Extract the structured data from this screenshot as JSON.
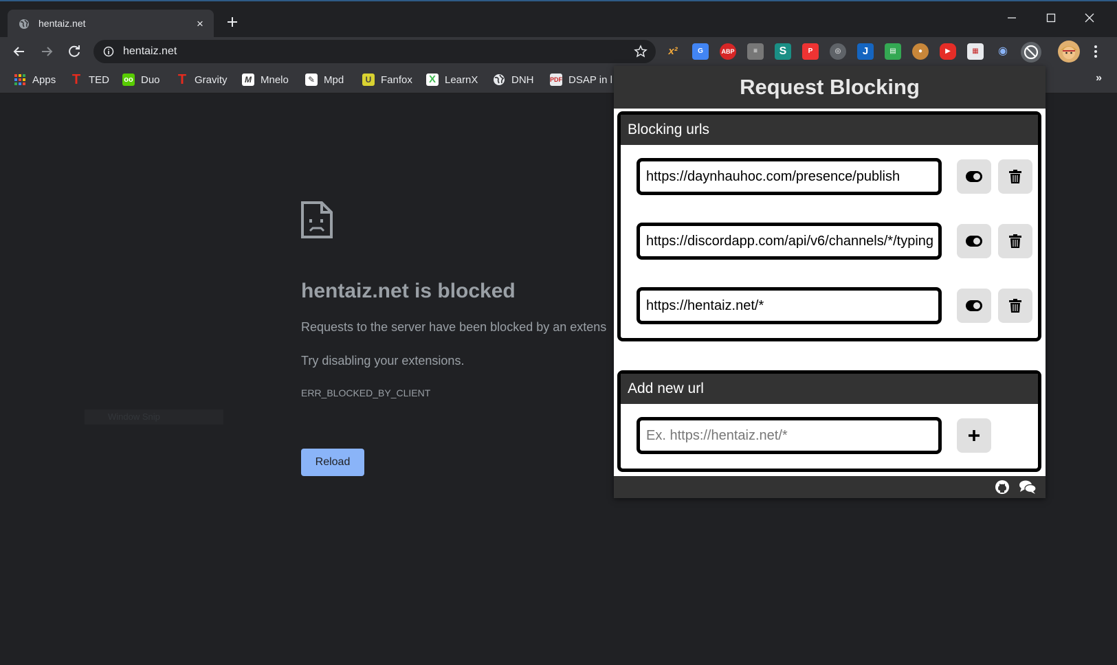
{
  "browser": {
    "tab_title": "hentaiz.net",
    "tab_close": "×",
    "address": "hentaiz.net",
    "bookmarks": [
      {
        "label": "Apps",
        "color": "#ea4335"
      },
      {
        "label": "TED",
        "color": "#e62b1e"
      },
      {
        "label": "Duo",
        "color": "#58cc02"
      },
      {
        "label": "Gravity",
        "color": "#e62b1e"
      },
      {
        "label": "Mnelo",
        "color": "#ffffff"
      },
      {
        "label": "Mpd",
        "color": "#ffffff"
      },
      {
        "label": "Fanfox",
        "color": "#d9d231"
      },
      {
        "label": "LearnX",
        "color": "#3fb950"
      },
      {
        "label": "DNH",
        "color": "#ffffff"
      },
      {
        "label": "DSAP in l",
        "color": "#e0e0e0"
      }
    ],
    "bookmarks_overflow": "»"
  },
  "error_page": {
    "title": "hentaiz.net is blocked",
    "line1": "Requests to the server have been blocked by an extens",
    "line2": "Try disabling your extensions.",
    "code": "ERR_BLOCKED_BY_CLIENT",
    "reload_label": "Reload",
    "ghost_text": "Window Snip"
  },
  "popup": {
    "title": "Request Blocking",
    "blocking_section": {
      "heading": "Blocking urls",
      "urls": [
        "https://daynhauhoc.com/presence/publish",
        "https://discordapp.com/api/v6/channels/*/typing",
        "https://hentaiz.net/*"
      ]
    },
    "add_section": {
      "heading": "Add new url",
      "placeholder": "Ex. https://hentaiz.net/*",
      "value": ""
    }
  },
  "colors": {
    "accent": "#8ab4f8",
    "popup_header": "#333333",
    "chrome_bg": "#35363a",
    "page_bg": "#202124"
  }
}
